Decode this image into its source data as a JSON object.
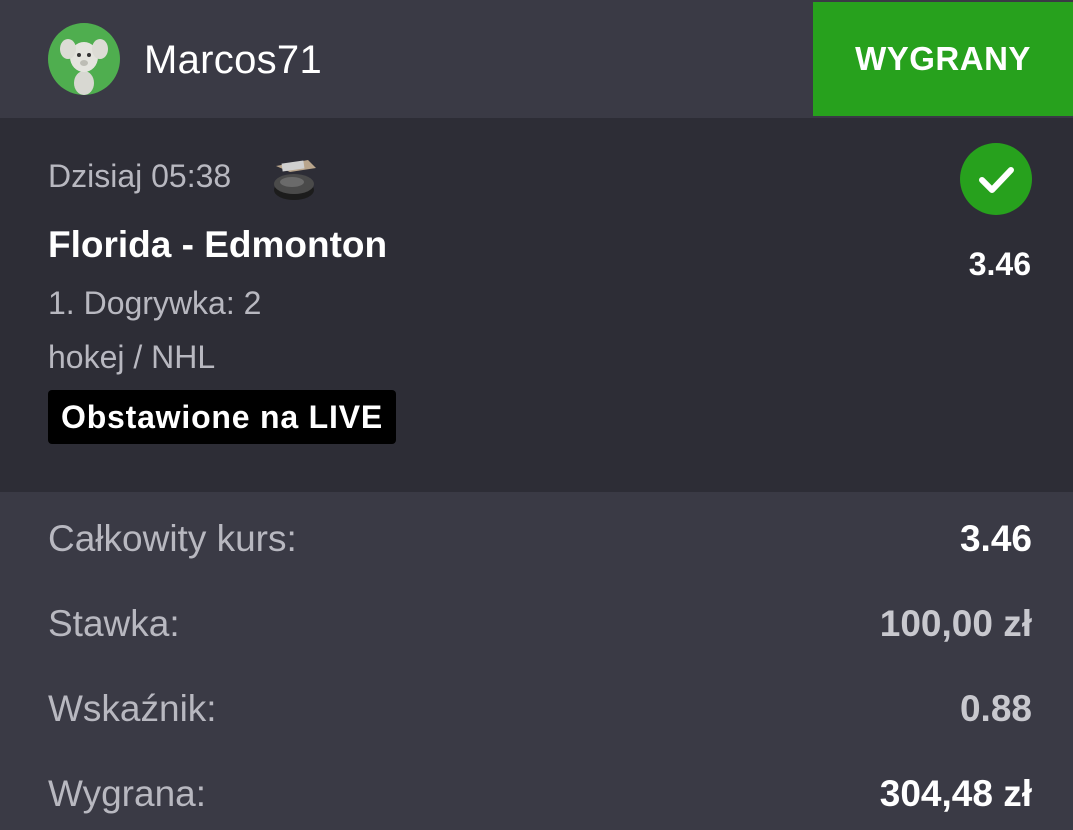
{
  "header": {
    "username": "Marcos71",
    "avatar_icon": "mascot-avatar-icon",
    "status_label": "WYGRANY",
    "status_color": "#27a11d"
  },
  "event": {
    "date": "Dzisiaj 05:38",
    "sport_icon": "hockey-puck-icon",
    "result_icon": "check-icon",
    "title": "Florida - Edmonton",
    "odds": "3.46",
    "market": "1. Dogrywka: 2",
    "league": "hokej / NHL",
    "live_tag": "Obstawione na LIVE"
  },
  "summary": {
    "total_odds_label": "Całkowity kurs:",
    "total_odds_value": "3.46",
    "stake_label": "Stawka:",
    "stake_value": "100,00 zł",
    "factor_label": "Wskaźnik:",
    "factor_value": "0.88",
    "payout_label": "Wygrana:",
    "payout_value": "304,48 zł"
  },
  "colors": {
    "background": "#3a3a45",
    "card": "#2d2d36",
    "win_green": "#27a11d",
    "muted_text": "#b8b8c0"
  }
}
